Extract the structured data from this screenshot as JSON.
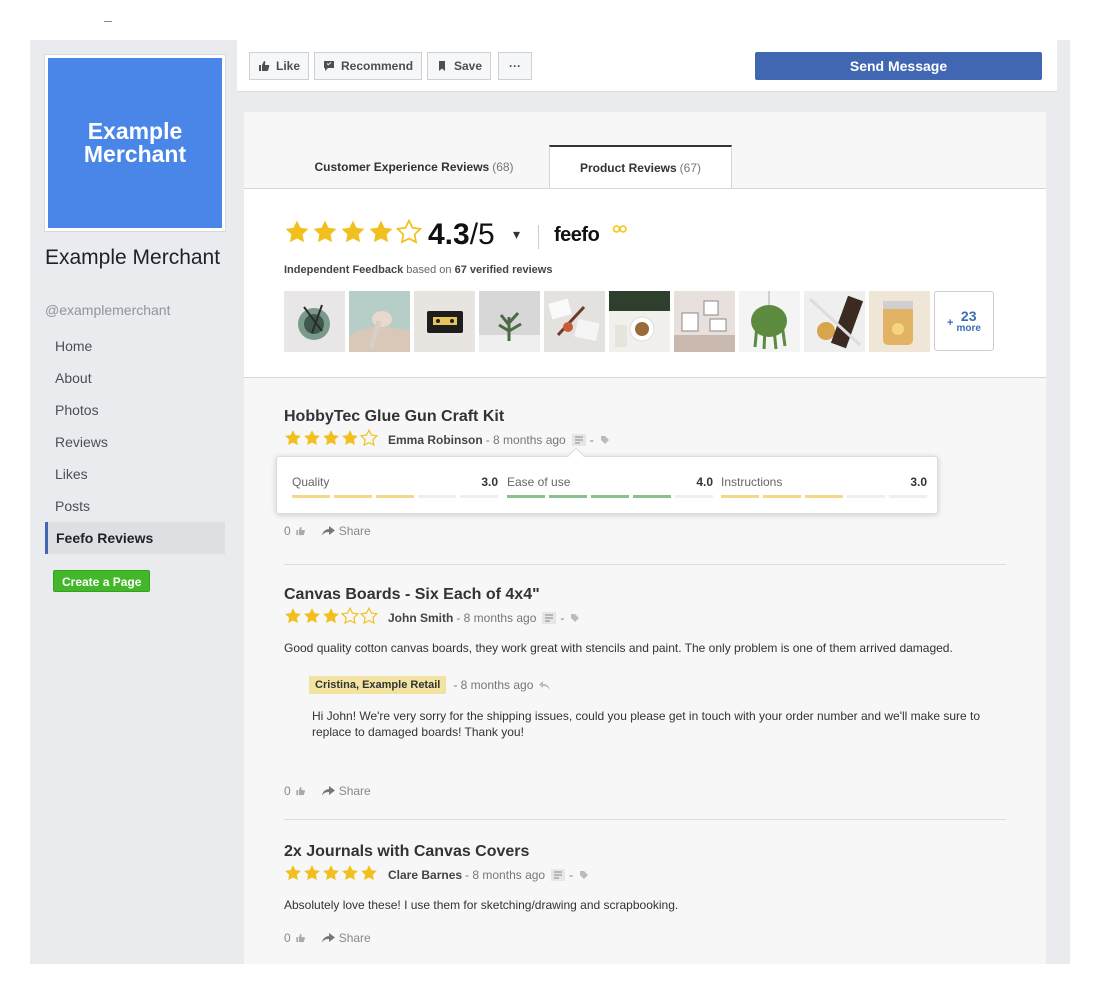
{
  "page": {
    "cover_text": "Example Merchant",
    "name": "Example Merchant",
    "handle": "@examplemerchant"
  },
  "nav": {
    "items": [
      {
        "label": "Home"
      },
      {
        "label": "About"
      },
      {
        "label": "Photos"
      },
      {
        "label": "Reviews"
      },
      {
        "label": "Likes"
      },
      {
        "label": "Posts"
      },
      {
        "label": "Feefo Reviews",
        "active": true
      }
    ],
    "create_page_label": "Create a Page"
  },
  "actions": {
    "like": "Like",
    "recommend": "Recommend",
    "save": "Save",
    "more": "···",
    "send_message": "Send Message"
  },
  "tabs": [
    {
      "label": "Customer Experience Reviews",
      "count": "(68)"
    },
    {
      "label": "Product Reviews",
      "count": "(67)",
      "active": true
    }
  ],
  "summary": {
    "rating": 4.3,
    "score_main": "4.3",
    "score_den": "/5",
    "caret": "▾",
    "brand": "feefo",
    "independent_prefix": "Independent Feedback",
    "based_on": "based on",
    "verified": "67 verified reviews",
    "more_count": "23",
    "more_label": "more",
    "thumbnail_count": 10
  },
  "reviews": [
    {
      "title": "HobbyTec Glue Gun Craft Kit",
      "stars": 4,
      "author": "Emma Robinson",
      "ago": "- 8 months ago",
      "sep": "-",
      "ratings": [
        {
          "name": "Quality",
          "value": "3.0",
          "filled": 3,
          "color": "#f1d88a"
        },
        {
          "name": "Ease of use",
          "value": "4.0",
          "filled": 4,
          "color": "#8bbf8b"
        },
        {
          "name": "Instructions",
          "value": "3.0",
          "filled": 3,
          "color": "#f1d88a"
        }
      ],
      "likes": "0",
      "share": "Share"
    },
    {
      "title": "Canvas Boards - Six Each of 4x4\"",
      "stars": 3,
      "author": "John Smith",
      "ago": "- 8 months ago",
      "sep": "-",
      "body": "Good quality cotton canvas boards, they work great with stencils and paint. The only problem is one of them arrived damaged.",
      "reply": {
        "from": "Cristina,  Example Retail",
        "ago": "- 8 months ago",
        "body": "Hi John! We're very sorry for the shipping issues, could you please get in touch with your order number and we'll make sure to replace to damaged boards! Thank you!"
      },
      "likes": "0",
      "share": "Share"
    },
    {
      "title": "2x Journals with Canvas Covers",
      "stars": 5,
      "author": "Clare Barnes",
      "ago": "- 8 months ago",
      "sep": "-",
      "body": "Absolutely love these! I use them for sketching/drawing and scrapbooking.",
      "likes": "0",
      "share": "Share"
    }
  ],
  "colors": {
    "star": "#f2c01e",
    "fb_blue": "#4267b2",
    "cover_blue": "#4a86e8",
    "green": "#42b72a",
    "reply_badge": "#f3e3a3"
  }
}
